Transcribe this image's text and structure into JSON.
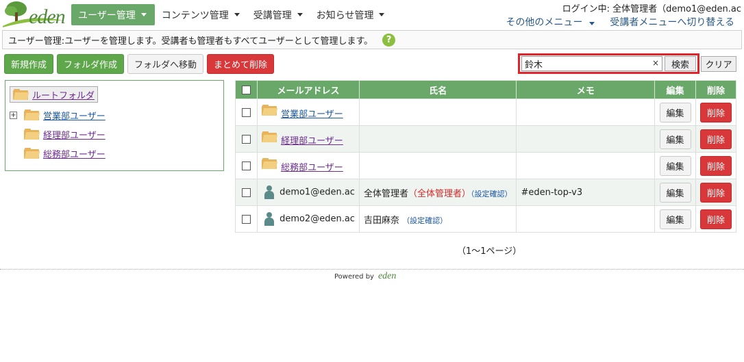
{
  "logo_text": "eden",
  "nav": [
    {
      "label": "ユーザー管理",
      "active": true
    },
    {
      "label": "コンテンツ管理",
      "active": false
    },
    {
      "label": "受講管理",
      "active": false
    },
    {
      "label": "お知らせ管理",
      "active": false
    }
  ],
  "login_info": "ログイン中: 全体管理者（demo1@eden.ac",
  "menu_right": {
    "other_menu": "その他のメニュー",
    "learner_switch": "受講者メニューへ切り替える"
  },
  "description": "ユーザー管理:ユーザーを管理します。受講者も管理者もすべてユーザーとして管理します。",
  "toolbar": {
    "new": "新規作成",
    "folder_create": "フォルダ作成",
    "move_to_folder": "フォルダへ移動",
    "bulk_delete": "まとめて削除"
  },
  "search": {
    "value": "鈴木",
    "clear_x": "×",
    "search_label": "検索",
    "clear_label": "クリア"
  },
  "tree": {
    "root": "ルートフォルダ",
    "folders": [
      "営業部ユーザー",
      "経理部ユーザー",
      "総務部ユーザー"
    ],
    "expand": "+"
  },
  "table": {
    "headers": {
      "email": "メールアドレス",
      "name": "氏名",
      "memo": "メモ",
      "edit": "編集",
      "delete": "削除"
    },
    "edit_label": "編集",
    "delete_label": "削除",
    "folder_rows": [
      "営業部ユーザー",
      "経理部ユーザー",
      "総務部ユーザー"
    ],
    "user_rows": [
      {
        "email": "demo1@eden.ac",
        "name": "全体管理者",
        "role": "（全体管理者）",
        "confirm": "（設定確認）",
        "memo": "#eden-top-v3"
      },
      {
        "email": "demo2@eden.ac",
        "name": "吉田麻奈",
        "role": "",
        "confirm": "（設定確認）",
        "memo": ""
      }
    ]
  },
  "pager": "（1～1ページ）",
  "footer": {
    "powered_by": "Powered by",
    "logo": "eden"
  },
  "colors": {
    "primary_green": "#6aa86a",
    "button_green": "#5ea84b",
    "danger_red": "#d9383a",
    "search_highlight": "#e0242b",
    "link_purple": "#6b2b8f",
    "link_blue": "#1a57a7"
  }
}
